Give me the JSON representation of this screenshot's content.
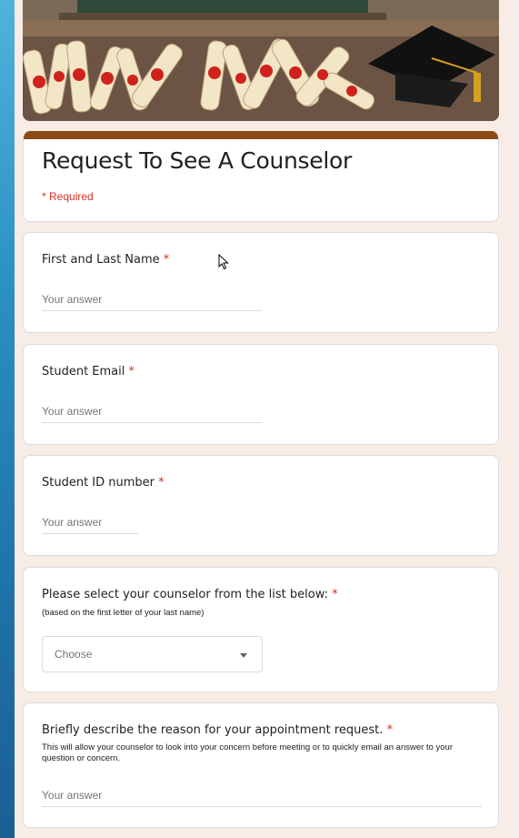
{
  "form": {
    "title": "Request To See A Counselor",
    "required_note": "* Required",
    "accent_color": "#8b4a14",
    "required_color": "#d93025"
  },
  "questions": [
    {
      "label": "First and Last Name",
      "required_mark": "*",
      "placeholder": "Your answer"
    },
    {
      "label": "Student Email",
      "required_mark": "*",
      "placeholder": "Your answer"
    },
    {
      "label": "Student ID number",
      "required_mark": "*",
      "placeholder": "Your answer"
    },
    {
      "label": "Please select your counselor from the list below:",
      "required_mark": "*",
      "description": "(based on the first letter of your last name)",
      "selected_value": "Choose"
    },
    {
      "label": "Briefly describe the reason for your appointment request.",
      "required_mark": "*",
      "description": "This will allow your counselor to look into your concern before meeting or to quickly email an answer to your question or concern.",
      "placeholder": "Your answer"
    }
  ],
  "icons": {
    "cursor": "mouse-pointer-icon",
    "dropdown": "caret-down-icon",
    "header_image": "graduation-diplomas-cap-image"
  }
}
